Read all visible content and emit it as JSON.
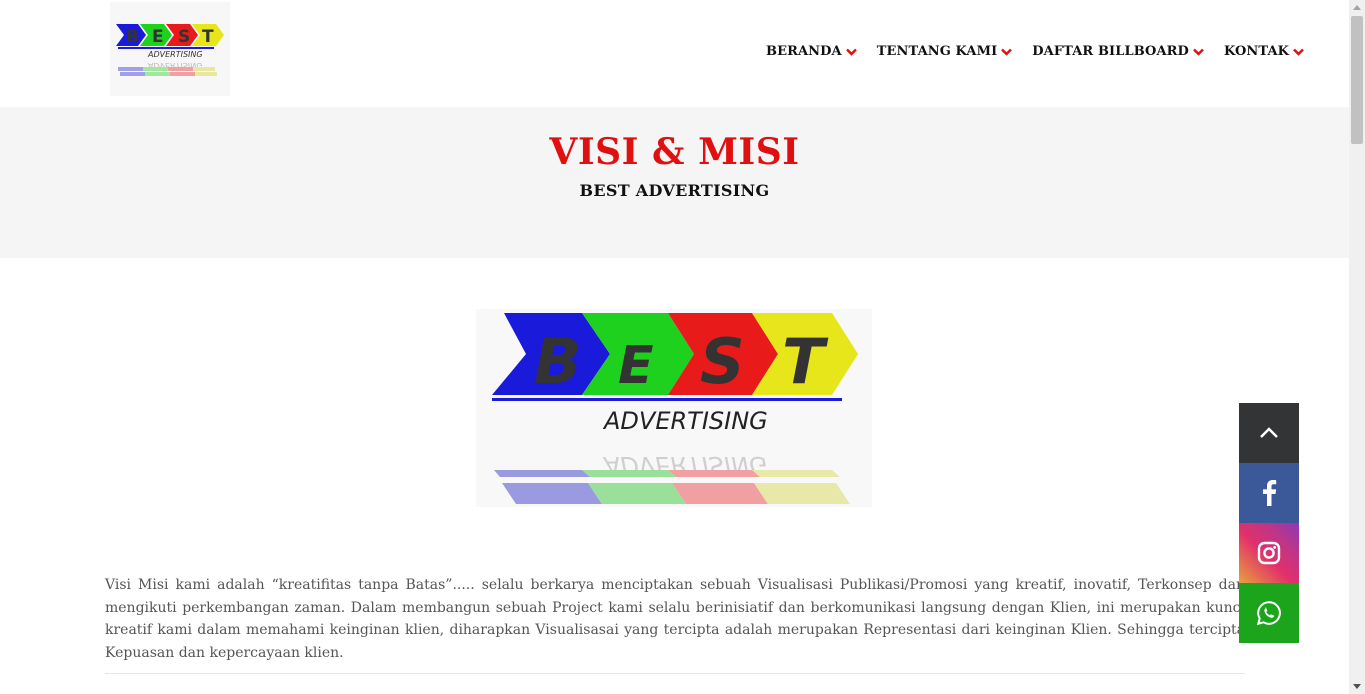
{
  "header": {
    "logo_alt": "BEST ADVERTISING",
    "nav": [
      {
        "label": "BERANDA"
      },
      {
        "label": "TENTANG KAMI"
      },
      {
        "label": "DAFTAR BILLBOARD"
      },
      {
        "label": "KONTAK"
      }
    ],
    "accent_color": "#e01010"
  },
  "hero": {
    "title": "VISI & MISI",
    "subtitle": "BEST ADVERTISING"
  },
  "logo": {
    "letters": [
      "B",
      "E",
      "S",
      "T"
    ],
    "tagline": "ADVERTISING",
    "colors": [
      "#1a1adb",
      "#1fd11f",
      "#e81a1a",
      "#e6e61a"
    ]
  },
  "content": {
    "paragraph": "Visi Misi kami adalah “kreatifitas tanpa Batas”..... selalu berkarya menciptakan sebuah Visualisasi Publikasi/Promosi yang kreatif, inovatif, Terkonsep dan mengikuti perkembangan zaman. Dalam membangun sebuah Project kami selalu berinisiatif dan berkomunikasi langsung dengan Klien, ini merupakan kunci kreatif kami dalam memahami keinginan klien, diharapkan Visualisasai yang tercipta adalah merupakan Representasi dari keinginan Klien. Sehingga tercipta Kepuasan dan kepercayaan klien."
  },
  "sidebar": {
    "icons": [
      "chevron-up-icon",
      "facebook-icon",
      "instagram-icon",
      "whatsapp-icon"
    ]
  }
}
